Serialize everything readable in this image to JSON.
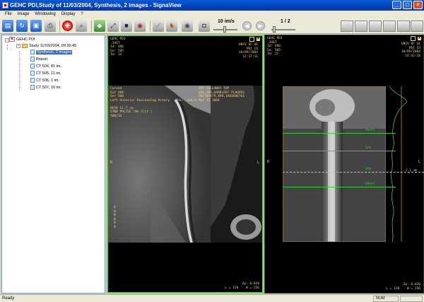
{
  "window": {
    "title": "GEHC PDI,Study of  11/03/2004, Synthesis, 2 images - SignaView",
    "controls": [
      "_",
      "□",
      "×"
    ]
  },
  "menu": [
    "File",
    "Image",
    "Windowing",
    "Display",
    "?"
  ],
  "toolbar": {
    "speed_label": "10 im/s",
    "page_label": "1 / 2",
    "icons": [
      "open-icon",
      "save-icon",
      "print-icon",
      "help-icon",
      "zoom-icon",
      "cube-icon",
      "fit-icon",
      "window-icon",
      "compass-icon",
      "ruler-icon",
      "walk-icon",
      "eye-icon",
      "camera-icon",
      "prev-icon",
      "next-icon"
    ]
  },
  "tree": {
    "root": "GEHC PDI",
    "study": "Study 11/03/2004, 09:36:45",
    "items": [
      "Synthesis, 2 images",
      "Report",
      "CT 504, 81 im.",
      "CT 505, 11 im.",
      "CT 506, 1 im.",
      "CT 507, 10 im."
    ]
  },
  "viewport_left": {
    "top_left": "GEHC PDI\n.3467\nId: 486\nSe: 505\nIm: 14",
    "top_right": "UNIV OF GE\nPDI CO\n10/09/2004\n12:17:11",
    "annotation": "Curved\nExt 486\nSer 500\nLeft Anterior Descending Artery   Thk: -100.0\n\nDFOV 11.7 cm\nSTND PhLTEE (No Filt.)\n500/14",
    "annotation_right": "AMI GALLOWAY TWP\nAMI,486,HARDLOST PLAQUES\nUN2704479,890,1983686761\nMar 11 2004",
    "bottom_left": "0\n0\n0\n0\n0\n0",
    "bottom_right": "Zp: 0.020\nL = 128    W = 256",
    "orient_left": "R",
    "orient_right": "L"
  },
  "viewport_right": {
    "top_left": "GEHC PDI\n.3467\nId: 486\nSe: 505\nIm: 22",
    "top_right": "UNIV OF GE\nPDI CO\n10/09/2004\n14:42:28",
    "bottom_right": "Zp: 0.020\nL = 128    W = 256",
    "graph_labels": [
      "PRef1",
      "Sta",
      "Stb",
      "DRef1"
    ],
    "measure": "2.1 mm",
    "orient_left": "R",
    "orient_right": "L"
  },
  "status": {
    "text": "Ready",
    "num": "NUM"
  }
}
